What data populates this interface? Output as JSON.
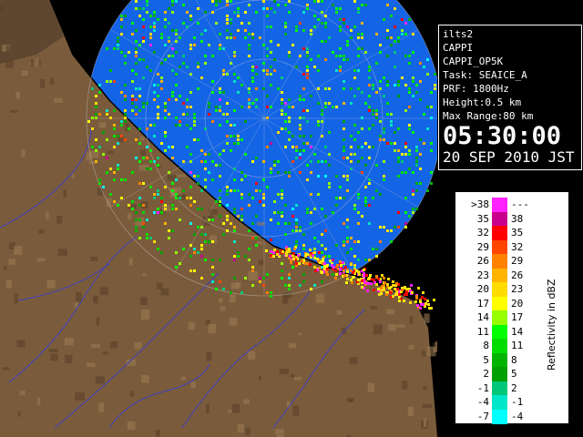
{
  "station": "ilts2",
  "product": "CAPPI",
  "product_name": "CAPPI_OP5K",
  "task": "Task: SEAICE_A",
  "prf": "PRF: 1800Hz",
  "height": "Height:0.5 km",
  "max_range": "Max Range:80 km",
  "time": "05:30:00",
  "date": "20 SEP 2010 JST",
  "legend": {
    "title": "Reflectivity in dBZ",
    "rows": [
      {
        "lo": ">38",
        "hi": "---",
        "color": "#ff22ff"
      },
      {
        "lo": "35",
        "hi": "38",
        "color": "#c8008c"
      },
      {
        "lo": "32",
        "hi": "35",
        "color": "#ff0000"
      },
      {
        "lo": "29",
        "hi": "32",
        "color": "#ff4600"
      },
      {
        "lo": "26",
        "hi": "29",
        "color": "#ff8200"
      },
      {
        "lo": "23",
        "hi": "26",
        "color": "#ffb400"
      },
      {
        "lo": "20",
        "hi": "23",
        "color": "#ffdc00"
      },
      {
        "lo": "17",
        "hi": "20",
        "color": "#ffff00"
      },
      {
        "lo": "14",
        "hi": "17",
        "color": "#96ff00"
      },
      {
        "lo": "11",
        "hi": "14",
        "color": "#00ff00"
      },
      {
        "lo": "8",
        "hi": "11",
        "color": "#00dc00"
      },
      {
        "lo": "5",
        "hi": "8",
        "color": "#00b400"
      },
      {
        "lo": "2",
        "hi": "5",
        "color": "#00a000"
      },
      {
        "lo": "-1",
        "hi": "2",
        "color": "#00c878"
      },
      {
        "lo": "-4",
        "hi": "-1",
        "color": "#00e6c8"
      },
      {
        "lo": "-7",
        "hi": "-4",
        "color": "#00ffff"
      }
    ]
  },
  "colors": {
    "sea": "#1464e6",
    "land": "#7a5c3c",
    "coast": "#000000",
    "rivers": "#4040c0",
    "range_ring": "#cccccc"
  }
}
